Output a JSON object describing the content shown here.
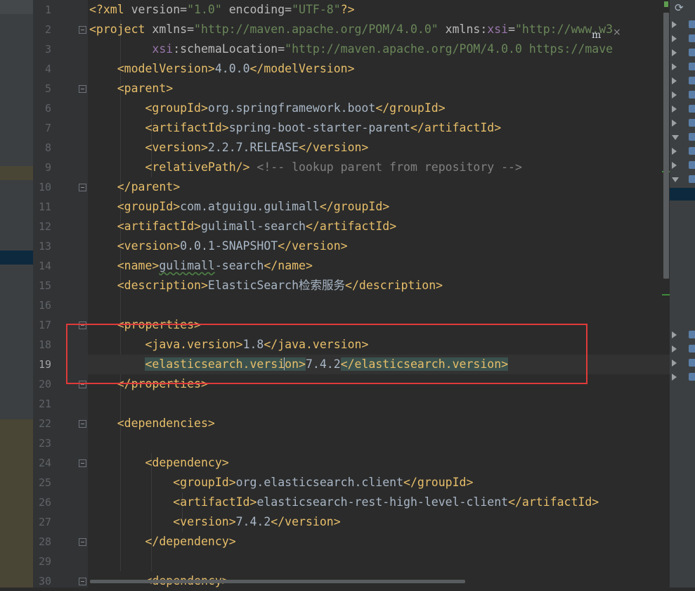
{
  "editor": {
    "current_line": 19,
    "lines": [
      {
        "n": 1,
        "indent": 0,
        "tokens": [
          {
            "t": "<?xml ",
            "c": "tg"
          },
          {
            "t": "version",
            "c": "an"
          },
          {
            "t": "=",
            "c": "an"
          },
          {
            "t": "\"1.0\"",
            "c": "av"
          },
          {
            "t": " encoding",
            "c": "an"
          },
          {
            "t": "=",
            "c": "an"
          },
          {
            "t": "\"UTF-8\"",
            "c": "av"
          },
          {
            "t": "?>",
            "c": "tg"
          }
        ]
      },
      {
        "n": 2,
        "indent": 0,
        "fold": true,
        "tokens": [
          {
            "t": "<project ",
            "c": "tg"
          },
          {
            "t": "xmlns",
            "c": "an"
          },
          {
            "t": "=",
            "c": "an"
          },
          {
            "t": "\"http://maven.apache.org/POM/4.0.0\"",
            "c": "av"
          },
          {
            "t": " xmlns",
            "c": "an"
          },
          {
            "t": ":",
            "c": "an"
          },
          {
            "t": "xsi",
            "c": "ns"
          },
          {
            "t": "=",
            "c": "an"
          },
          {
            "t": "\"http://www.w3",
            "c": "av"
          }
        ]
      },
      {
        "n": 3,
        "indent": 9,
        "tokens": [
          {
            "t": "xsi",
            "c": "ns"
          },
          {
            "t": ":schemaLocation",
            "c": "an"
          },
          {
            "t": "=",
            "c": "an"
          },
          {
            "t": "\"http://maven.apache.org/POM/4.0.0 https://mave",
            "c": "av"
          }
        ]
      },
      {
        "n": 4,
        "indent": 4,
        "tokens": [
          {
            "t": "<modelVersion>",
            "c": "tg"
          },
          {
            "t": "4.0.0",
            "c": "tx"
          },
          {
            "t": "</modelVersion>",
            "c": "tg"
          }
        ]
      },
      {
        "n": 5,
        "indent": 4,
        "fold": true,
        "tokens": [
          {
            "t": "<parent>",
            "c": "tg"
          }
        ]
      },
      {
        "n": 6,
        "indent": 8,
        "tokens": [
          {
            "t": "<groupId>",
            "c": "tg"
          },
          {
            "t": "org.springframework.boot",
            "c": "tx"
          },
          {
            "t": "</groupId>",
            "c": "tg"
          }
        ]
      },
      {
        "n": 7,
        "indent": 8,
        "tokens": [
          {
            "t": "<artifactId>",
            "c": "tg"
          },
          {
            "t": "spring-boot-starter-parent",
            "c": "tx"
          },
          {
            "t": "</artifactId>",
            "c": "tg"
          }
        ]
      },
      {
        "n": 8,
        "indent": 8,
        "tokens": [
          {
            "t": "<version>",
            "c": "tg"
          },
          {
            "t": "2.2.7.RELEASE",
            "c": "tx"
          },
          {
            "t": "</version>",
            "c": "tg"
          }
        ]
      },
      {
        "n": 9,
        "indent": 8,
        "tokens": [
          {
            "t": "<relativePath/>",
            "c": "tg"
          },
          {
            "t": " <!-- lookup parent from repository -->",
            "c": "cm"
          }
        ]
      },
      {
        "n": 10,
        "indent": 4,
        "fold": true,
        "tokens": [
          {
            "t": "</parent>",
            "c": "tg"
          }
        ]
      },
      {
        "n": 11,
        "indent": 4,
        "tokens": [
          {
            "t": "<groupId>",
            "c": "tg"
          },
          {
            "t": "com.atguigu.gulimall",
            "c": "tx"
          },
          {
            "t": "</groupId>",
            "c": "tg"
          }
        ]
      },
      {
        "n": 12,
        "indent": 4,
        "tokens": [
          {
            "t": "<artifactId>",
            "c": "tg"
          },
          {
            "t": "gulimall-search",
            "c": "tx"
          },
          {
            "t": "</artifactId>",
            "c": "tg"
          }
        ]
      },
      {
        "n": 13,
        "indent": 4,
        "tokens": [
          {
            "t": "<version>",
            "c": "tg"
          },
          {
            "t": "0.0.1-SNAPSHOT",
            "c": "tx"
          },
          {
            "t": "</version>",
            "c": "tg"
          }
        ]
      },
      {
        "n": 14,
        "indent": 4,
        "tokens": [
          {
            "t": "<name>",
            "c": "tg"
          },
          {
            "t": "gulimall",
            "c": "sq"
          },
          {
            "t": "-search",
            "c": "tx"
          },
          {
            "t": "</name>",
            "c": "tg"
          }
        ]
      },
      {
        "n": 15,
        "indent": 4,
        "tokens": [
          {
            "t": "<description>",
            "c": "tg"
          },
          {
            "t": "ElasticSearch检索服务",
            "c": "tx"
          },
          {
            "t": "</description>",
            "c": "tg"
          }
        ]
      },
      {
        "n": 16,
        "indent": 0,
        "tokens": []
      },
      {
        "n": 17,
        "indent": 4,
        "fold": true,
        "tokens": [
          {
            "t": "<properties>",
            "c": "tg"
          }
        ]
      },
      {
        "n": 18,
        "indent": 8,
        "tokens": [
          {
            "t": "<java.version>",
            "c": "tg"
          },
          {
            "t": "1.8",
            "c": "tx"
          },
          {
            "t": "</java.version>",
            "c": "tg"
          }
        ]
      },
      {
        "n": 19,
        "indent": 8,
        "tokens": [
          {
            "t": "<elasticsearch.versi",
            "c": "tgh"
          },
          {
            "t": "",
            "c": "caret"
          },
          {
            "t": "on>",
            "c": "tgh"
          },
          {
            "t": "7.4.2",
            "c": "tx"
          },
          {
            "t": "</elasticsearch.version>",
            "c": "tgh"
          }
        ]
      },
      {
        "n": 20,
        "indent": 4,
        "fold": true,
        "tokens": [
          {
            "t": "</properties>",
            "c": "tg"
          }
        ]
      },
      {
        "n": 21,
        "indent": 0,
        "tokens": []
      },
      {
        "n": 22,
        "indent": 4,
        "fold": true,
        "tokens": [
          {
            "t": "<dependencies>",
            "c": "tg"
          }
        ]
      },
      {
        "n": 23,
        "indent": 0,
        "tokens": []
      },
      {
        "n": 24,
        "indent": 8,
        "fold": true,
        "tokens": [
          {
            "t": "<dependency>",
            "c": "tg"
          }
        ]
      },
      {
        "n": 25,
        "indent": 12,
        "tokens": [
          {
            "t": "<groupId>",
            "c": "tg"
          },
          {
            "t": "org.elasticsearch.client",
            "c": "tx"
          },
          {
            "t": "</groupId>",
            "c": "tg"
          }
        ]
      },
      {
        "n": 26,
        "indent": 12,
        "tokens": [
          {
            "t": "<artifactId>",
            "c": "tg"
          },
          {
            "t": "elasticsearch-rest-high-level-client",
            "c": "tx"
          },
          {
            "t": "</artifactId>",
            "c": "tg"
          }
        ]
      },
      {
        "n": 27,
        "indent": 12,
        "tokens": [
          {
            "t": "<version>",
            "c": "tg"
          },
          {
            "t": "7.4.2",
            "c": "tx"
          },
          {
            "t": "</version>",
            "c": "tg"
          }
        ]
      },
      {
        "n": 28,
        "indent": 8,
        "fold": true,
        "tokens": [
          {
            "t": "</dependency>",
            "c": "tg"
          }
        ]
      },
      {
        "n": 29,
        "indent": 0,
        "tokens": []
      },
      {
        "n": 30,
        "indent": 8,
        "fold": true,
        "tokens": [
          {
            "t": "<dependency>",
            "c": "tg"
          }
        ]
      }
    ]
  },
  "overlays": {
    "maven_badge": "m",
    "close_glyph": "×"
  },
  "right_panel": {
    "refresh_icon": "⟳",
    "items": [
      {
        "kind": "arrow"
      },
      {
        "kind": "arrow"
      },
      {
        "kind": "arrow"
      },
      {
        "kind": "arrow"
      },
      {
        "kind": "arrow"
      },
      {
        "kind": "arrow"
      },
      {
        "kind": "arrow"
      },
      {
        "kind": "arrow"
      },
      {
        "kind": "down"
      },
      {
        "kind": "arrow"
      },
      {
        "kind": "arrow"
      },
      {
        "kind": "down"
      }
    ],
    "lower_items": [
      {
        "kind": "arrow"
      },
      {
        "kind": "arrow"
      },
      {
        "kind": "arrow"
      },
      {
        "kind": "arrow"
      }
    ]
  },
  "colors": {
    "background": "#2b2b2b",
    "tag": "#e8bf6a",
    "attribute_value": "#6a8759",
    "text": "#a9b7c6",
    "highlight_box": "#e03a3a"
  }
}
